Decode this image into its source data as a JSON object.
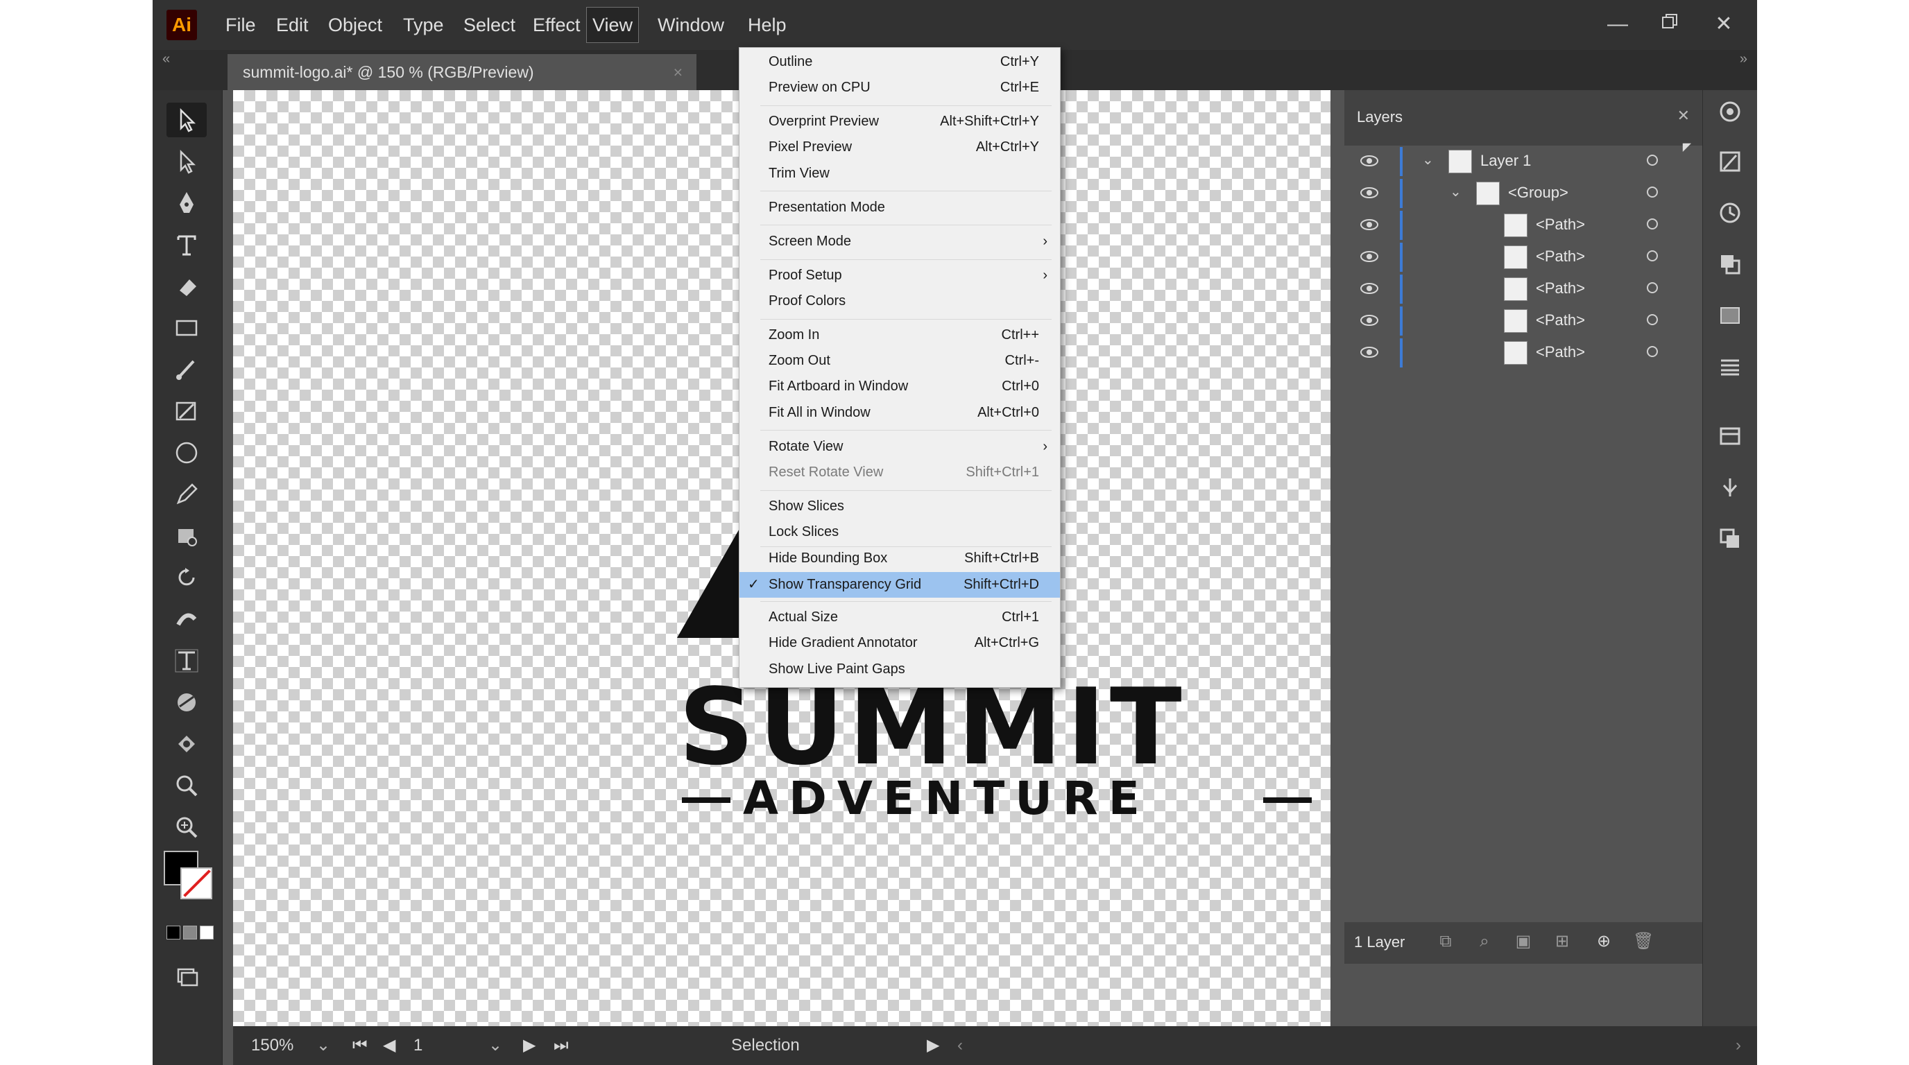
{
  "app": {
    "logo_text": "Ai"
  },
  "menubar": {
    "items": [
      "File",
      "Edit",
      "Object",
      "Type",
      "Select",
      "Effect",
      "View",
      "Window",
      "Help"
    ],
    "active": "View"
  },
  "document_tab": {
    "title": "summit-logo.ai* @ 150 % (RGB/Preview)",
    "close_glyph": "×"
  },
  "view_menu": {
    "items": [
      {
        "label": "Outline",
        "shortcut": "Ctrl+Y"
      },
      {
        "label": "Preview on CPU",
        "shortcut": "Ctrl+E"
      },
      {
        "label": "Overprint Preview",
        "shortcut": "Alt+Shift+Ctrl+Y"
      },
      {
        "label": "Pixel Preview",
        "shortcut": "Alt+Ctrl+Y"
      },
      {
        "label": "Trim View",
        "shortcut": ""
      },
      {
        "label": "Presentation Mode",
        "shortcut": ""
      },
      {
        "label": "Screen Mode",
        "shortcut": "",
        "submenu": true
      },
      {
        "label": "Proof Setup",
        "shortcut": "",
        "submenu": true
      },
      {
        "label": "Proof Colors",
        "shortcut": ""
      },
      {
        "label": "Zoom In",
        "shortcut": "Ctrl++"
      },
      {
        "label": "Zoom Out",
        "shortcut": "Ctrl+-"
      },
      {
        "label": "Fit Artboard in Window",
        "shortcut": "Ctrl+0"
      },
      {
        "label": "Fit All in Window",
        "shortcut": "Alt+Ctrl+0"
      },
      {
        "label": "Rotate View",
        "shortcut": "",
        "submenu": true
      },
      {
        "label": "Reset Rotate View",
        "shortcut": "Shift+Ctrl+1",
        "disabled": true
      },
      {
        "label": "Show Slices",
        "shortcut": ""
      },
      {
        "label": "Lock Slices",
        "shortcut": ""
      },
      {
        "label": "Hide Bounding Box",
        "shortcut": "Shift+Ctrl+B"
      },
      {
        "label": "Show Transparency Grid",
        "shortcut": "Shift+Ctrl+D",
        "checked": true,
        "highlighted": true
      },
      {
        "label": "Actual Size",
        "shortcut": "Ctrl+1"
      },
      {
        "label": "Hide Gradient Annotator",
        "shortcut": "Alt+Ctrl+G"
      },
      {
        "label": "Show Live Paint Gaps",
        "shortcut": ""
      }
    ]
  },
  "artwork": {
    "title": "SUMMIT",
    "subtitle": "ADVENTURE"
  },
  "layers_panel": {
    "title": "Layers",
    "rows": [
      {
        "name": "Layer 1",
        "expanded": true
      },
      {
        "name": "<Group>",
        "expanded": true
      },
      {
        "name": "<Path>"
      },
      {
        "name": "<Path>"
      },
      {
        "name": "<Path>"
      },
      {
        "name": "<Path>"
      },
      {
        "name": "<Path>"
      }
    ],
    "footer_count": "1 Layer"
  },
  "status_bar": {
    "zoom": "150%",
    "artboard": "1",
    "tool": "Selection"
  },
  "colors": {
    "app_bg": "#535353",
    "menubar_bg": "#323232",
    "menu_highlight": "#9cc3ef",
    "layer_bar": "#3d7bd6"
  }
}
